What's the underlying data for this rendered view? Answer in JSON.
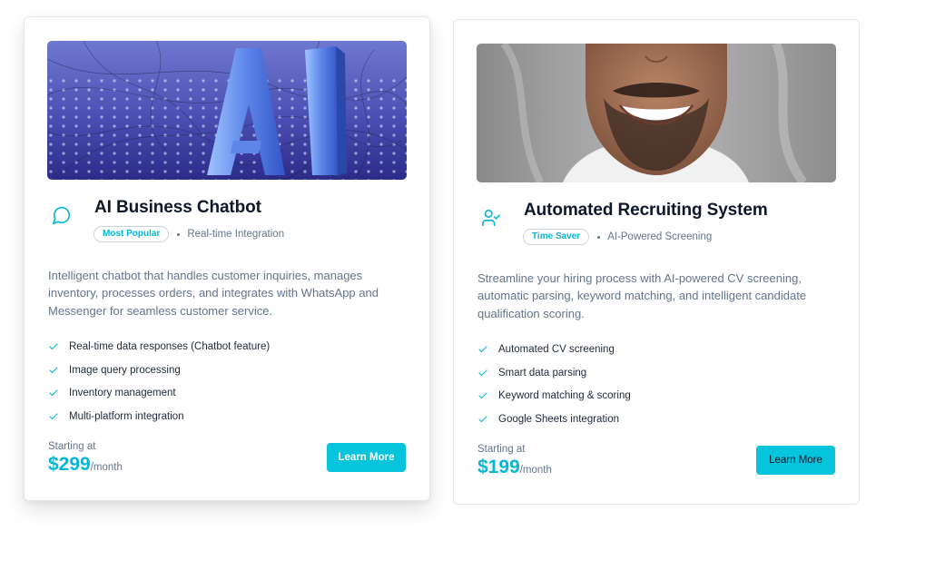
{
  "colors": {
    "accent": "#06b6d4",
    "button": "#06c4dc",
    "text_muted": "#64748b",
    "title": "#0f172a"
  },
  "cards": [
    {
      "image_subject": "3D blue letters AI on glowing grid",
      "icon": "message-circle-icon",
      "title": "AI Business Chatbot",
      "badge": "Most Popular",
      "meta": "Real-time Integration",
      "description": "Intelligent chatbot that handles customer inquiries, manages inventory, processes orders, and integrates with WhatsApp and Messenger for seamless customer service.",
      "features": [
        "Real-time data responses (Chatbot feature)",
        "Image query processing",
        "Inventory management",
        "Multi-platform integration"
      ],
      "price_label": "Starting at",
      "price": "$299",
      "period": "/month",
      "button": "Learn More"
    },
    {
      "image_subject": "smiling man with beard, close-up",
      "icon": "user-check-icon",
      "title": "Automated Recruiting System",
      "badge": "Time Saver",
      "meta": "AI-Powered Screening",
      "description": "Streamline your hiring process with AI-powered CV screening, automatic parsing, keyword matching, and intelligent candidate qualification scoring.",
      "features": [
        "Automated CV screening",
        "Smart data parsing",
        "Keyword matching & scoring",
        "Google Sheets integration"
      ],
      "price_label": "Starting at",
      "price": "$199",
      "period": "/month",
      "button": "Learn More"
    }
  ]
}
